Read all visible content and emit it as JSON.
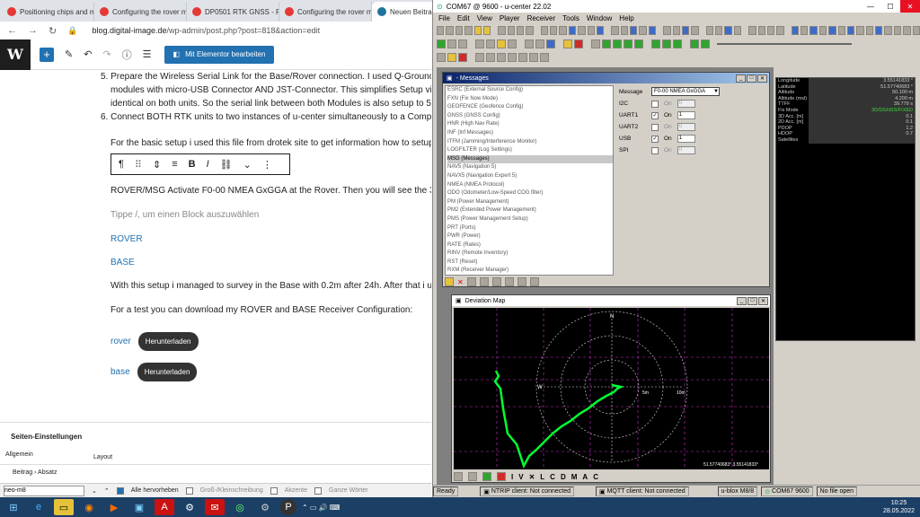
{
  "browser": {
    "tabs": [
      {
        "title": "Positioning chips and mo",
        "color": "#e53935"
      },
      {
        "title": "Configuring the rover mo",
        "color": "#e53935"
      },
      {
        "title": "DP0501 RTK GNSS - RTK I",
        "color": "#e53935"
      },
      {
        "title": "Configuring the rover mo",
        "color": "#e53935"
      },
      {
        "title": "Neuen Beitrag erst",
        "color": "#21759b",
        "active": true
      }
    ],
    "url_host": "blog.digital-image.de",
    "url_path": "/wp-admin/post.php?post=818&action=edit"
  },
  "wp": {
    "logo": "W",
    "elementor_label": "Mit Elementor bearbeiten"
  },
  "content": {
    "item5_num": "5.",
    "item5_line1": "Prepare the Wireless Serial Link for the Base/Rover connection. I used Q-Ground Con",
    "item5_line2": "modules with micro-USB Connector AND JST-Connector. This simplifies Setup via Con",
    "item5_line3": "identical on both units. So the serial link between both Modules is also setup to 5760",
    "item6_num": "6.",
    "item6_line1": "Connect BOTH RTK units to two instances of u-center simultaneously to a Computer w",
    "para1": "For the basic setup i used this file from drotek site to get information how to setup th",
    "para2": "ROVER/MSG Activate F0-00 NMEA GxGGA at the Rover. Then you will see the 3D/DGN",
    "placeholder": "Tippe /, um einen Block auszuwählen",
    "rover": "ROVER",
    "base": "BASE",
    "para3": "With this setup i managed to survey in the Base with 0.2m after 24h. After that i used",
    "para4": "For a test you can download my ROVER and BASE Receiver Configuration:",
    "dl1_link": "rover",
    "dl2_link": "base",
    "dl_button": "Herunterladen"
  },
  "settings": {
    "title": "Seiten-Einstellungen",
    "col1": "Allgemein",
    "col2": "Layout",
    "breadcrumb1": "Beitrag",
    "breadcrumb2": "Absatz"
  },
  "findbar": {
    "value": "neo-m8",
    "opt1": "Alle hervorheben",
    "opt2": "Groß-/Kleinschreibung",
    "opt3": "Akzente",
    "opt4": "Ganze Wörter"
  },
  "ucenter": {
    "title": "COM67 @ 9600 - u-center 22.02",
    "menu": [
      "File",
      "Edit",
      "View",
      "Player",
      "Receiver",
      "Tools",
      "Window",
      "Help"
    ],
    "messages_title": "- Messages",
    "messages": [
      "ESRC (External Source Config)",
      "FXN (Fix Now Mode)",
      "GEOFENCE (Geofence Config)",
      "GNSS (GNSS Config)",
      "HNR (High Nav Rate)",
      "INF (Inf Messages)",
      "ITFM (Jamming/Interference Monitor)",
      "LOGFILTER (Log Settings)",
      "MSG (Messages)",
      "NAV5 (Navigation 5)",
      "NAVX5 (Navigation Expert 5)",
      "NMEA (NMEA Protocol)",
      "ODO (Odometer/Low-Speed COG filter)",
      "PM (Power Management)",
      "PM2 (Extended Power Management)",
      "PMS (Power Management Setup)",
      "PRT (Ports)",
      "PWR (Power)",
      "RATE (Rates)",
      "RINV (Remote Inventory)",
      "RST (Reset)",
      "RXM (Receiver Manager)"
    ],
    "selected_message": "MSG (Messages)",
    "form": {
      "message_label": "Message",
      "message_value": "F0-00 NMEA GxGGA",
      "on_label": "On",
      "ports": [
        {
          "name": "I2C",
          "on": false,
          "value": "0"
        },
        {
          "name": "UART1",
          "on": true,
          "value": "1"
        },
        {
          "name": "UART2",
          "on": false,
          "value": "0"
        },
        {
          "name": "USB",
          "on": true,
          "value": "1"
        },
        {
          "name": "SPI",
          "on": false,
          "value": "0"
        }
      ]
    },
    "devmap": {
      "title": "Deviation Map",
      "north": "N",
      "west": "W",
      "ring1": "5m",
      "ring2": "10m",
      "coords": "51.57740683° 3.55141833°",
      "tools": [
        "I",
        "V",
        "L",
        "C",
        "D",
        "M",
        "A",
        "C"
      ]
    },
    "info": [
      {
        "k": "Longitude",
        "v": "3.55141833 °"
      },
      {
        "k": "Latitude",
        "v": "51.57740683 °"
      },
      {
        "k": "Altitude",
        "v": "50.100 m"
      },
      {
        "k": "Altitude (msl)",
        "v": "4.200 m"
      },
      {
        "k": "TTFF",
        "v": "39.779 s"
      },
      {
        "k": "Fix Mode",
        "v": "3D/DGNSS/FIXED"
      },
      {
        "k": "3D Acc. [m]",
        "v": "0.1"
      },
      {
        "k": "2D Acc. [m]",
        "v": "0.1"
      },
      {
        "k": "PDOP",
        "v": "1.2"
      },
      {
        "k": "HDOP",
        "v": "0.7"
      },
      {
        "k": "Satellites",
        "v": ""
      }
    ],
    "status": {
      "ready": "Ready",
      "ntrip": "NTRIP client: Not connected",
      "mqtt": "MQTT client: Not connected",
      "device": "u-blox M8/8",
      "port": "COM67 9600",
      "file": "No file open"
    }
  },
  "taskbar": {
    "time": "10:25",
    "date": "28.05.2022"
  },
  "colors": {
    "wp_blue": "#2271b1",
    "taskbar": "#1c3f66",
    "track": "#00ff33",
    "grid_magenta": "#cc33cc"
  }
}
